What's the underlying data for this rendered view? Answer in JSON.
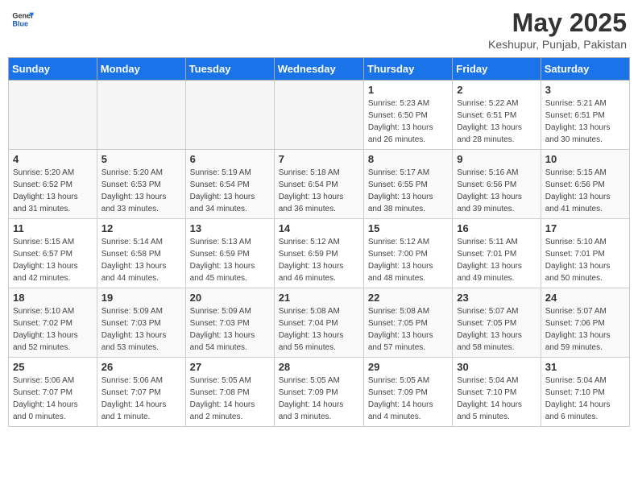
{
  "header": {
    "logo_general": "General",
    "logo_blue": "Blue",
    "month_year": "May 2025",
    "location": "Keshupur, Punjab, Pakistan"
  },
  "days_of_week": [
    "Sunday",
    "Monday",
    "Tuesday",
    "Wednesday",
    "Thursday",
    "Friday",
    "Saturday"
  ],
  "weeks": [
    [
      {
        "day": "",
        "info": ""
      },
      {
        "day": "",
        "info": ""
      },
      {
        "day": "",
        "info": ""
      },
      {
        "day": "",
        "info": ""
      },
      {
        "day": "1",
        "info": "Sunrise: 5:23 AM\nSunset: 6:50 PM\nDaylight: 13 hours\nand 26 minutes."
      },
      {
        "day": "2",
        "info": "Sunrise: 5:22 AM\nSunset: 6:51 PM\nDaylight: 13 hours\nand 28 minutes."
      },
      {
        "day": "3",
        "info": "Sunrise: 5:21 AM\nSunset: 6:51 PM\nDaylight: 13 hours\nand 30 minutes."
      }
    ],
    [
      {
        "day": "4",
        "info": "Sunrise: 5:20 AM\nSunset: 6:52 PM\nDaylight: 13 hours\nand 31 minutes."
      },
      {
        "day": "5",
        "info": "Sunrise: 5:20 AM\nSunset: 6:53 PM\nDaylight: 13 hours\nand 33 minutes."
      },
      {
        "day": "6",
        "info": "Sunrise: 5:19 AM\nSunset: 6:54 PM\nDaylight: 13 hours\nand 34 minutes."
      },
      {
        "day": "7",
        "info": "Sunrise: 5:18 AM\nSunset: 6:54 PM\nDaylight: 13 hours\nand 36 minutes."
      },
      {
        "day": "8",
        "info": "Sunrise: 5:17 AM\nSunset: 6:55 PM\nDaylight: 13 hours\nand 38 minutes."
      },
      {
        "day": "9",
        "info": "Sunrise: 5:16 AM\nSunset: 6:56 PM\nDaylight: 13 hours\nand 39 minutes."
      },
      {
        "day": "10",
        "info": "Sunrise: 5:15 AM\nSunset: 6:56 PM\nDaylight: 13 hours\nand 41 minutes."
      }
    ],
    [
      {
        "day": "11",
        "info": "Sunrise: 5:15 AM\nSunset: 6:57 PM\nDaylight: 13 hours\nand 42 minutes."
      },
      {
        "day": "12",
        "info": "Sunrise: 5:14 AM\nSunset: 6:58 PM\nDaylight: 13 hours\nand 44 minutes."
      },
      {
        "day": "13",
        "info": "Sunrise: 5:13 AM\nSunset: 6:59 PM\nDaylight: 13 hours\nand 45 minutes."
      },
      {
        "day": "14",
        "info": "Sunrise: 5:12 AM\nSunset: 6:59 PM\nDaylight: 13 hours\nand 46 minutes."
      },
      {
        "day": "15",
        "info": "Sunrise: 5:12 AM\nSunset: 7:00 PM\nDaylight: 13 hours\nand 48 minutes."
      },
      {
        "day": "16",
        "info": "Sunrise: 5:11 AM\nSunset: 7:01 PM\nDaylight: 13 hours\nand 49 minutes."
      },
      {
        "day": "17",
        "info": "Sunrise: 5:10 AM\nSunset: 7:01 PM\nDaylight: 13 hours\nand 50 minutes."
      }
    ],
    [
      {
        "day": "18",
        "info": "Sunrise: 5:10 AM\nSunset: 7:02 PM\nDaylight: 13 hours\nand 52 minutes."
      },
      {
        "day": "19",
        "info": "Sunrise: 5:09 AM\nSunset: 7:03 PM\nDaylight: 13 hours\nand 53 minutes."
      },
      {
        "day": "20",
        "info": "Sunrise: 5:09 AM\nSunset: 7:03 PM\nDaylight: 13 hours\nand 54 minutes."
      },
      {
        "day": "21",
        "info": "Sunrise: 5:08 AM\nSunset: 7:04 PM\nDaylight: 13 hours\nand 56 minutes."
      },
      {
        "day": "22",
        "info": "Sunrise: 5:08 AM\nSunset: 7:05 PM\nDaylight: 13 hours\nand 57 minutes."
      },
      {
        "day": "23",
        "info": "Sunrise: 5:07 AM\nSunset: 7:05 PM\nDaylight: 13 hours\nand 58 minutes."
      },
      {
        "day": "24",
        "info": "Sunrise: 5:07 AM\nSunset: 7:06 PM\nDaylight: 13 hours\nand 59 minutes."
      }
    ],
    [
      {
        "day": "25",
        "info": "Sunrise: 5:06 AM\nSunset: 7:07 PM\nDaylight: 14 hours\nand 0 minutes."
      },
      {
        "day": "26",
        "info": "Sunrise: 5:06 AM\nSunset: 7:07 PM\nDaylight: 14 hours\nand 1 minute."
      },
      {
        "day": "27",
        "info": "Sunrise: 5:05 AM\nSunset: 7:08 PM\nDaylight: 14 hours\nand 2 minutes."
      },
      {
        "day": "28",
        "info": "Sunrise: 5:05 AM\nSunset: 7:09 PM\nDaylight: 14 hours\nand 3 minutes."
      },
      {
        "day": "29",
        "info": "Sunrise: 5:05 AM\nSunset: 7:09 PM\nDaylight: 14 hours\nand 4 minutes."
      },
      {
        "day": "30",
        "info": "Sunrise: 5:04 AM\nSunset: 7:10 PM\nDaylight: 14 hours\nand 5 minutes."
      },
      {
        "day": "31",
        "info": "Sunrise: 5:04 AM\nSunset: 7:10 PM\nDaylight: 14 hours\nand 6 minutes."
      }
    ]
  ]
}
